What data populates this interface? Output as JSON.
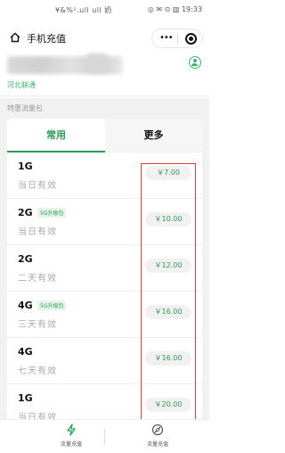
{
  "status_bar": {
    "left": "¥&%¹.ull ull 奶",
    "right": "◎ ✉ ⊙ ▥ 19:33"
  },
  "nav": {
    "title": "手机充值",
    "menu_dots": "•••"
  },
  "phone": {
    "carrier": "河北联通"
  },
  "section": {
    "label": "特惠流量包"
  },
  "tabs": {
    "active": "常用",
    "other": "更多"
  },
  "packages": [
    {
      "data": "1G",
      "badge": "",
      "validity": "当日有效",
      "price": "￥7.00"
    },
    {
      "data": "2G",
      "badge": "5G升级包",
      "validity": "当日有效",
      "price": "￥10.00"
    },
    {
      "data": "2G",
      "badge": "",
      "validity": "二天有效",
      "price": "￥12.00"
    },
    {
      "data": "4G",
      "badge": "5G升级包",
      "validity": "三天有效",
      "price": "￥16.00"
    },
    {
      "data": "4G",
      "badge": "",
      "validity": "七天有效",
      "price": "￥16.00"
    },
    {
      "data": "1G",
      "badge": "",
      "validity": "当日有效",
      "price": "￥20.00"
    }
  ],
  "tabbar": {
    "left_label": "流量充值",
    "right_label": "流量充值"
  },
  "colors": {
    "accent": "#2a9c56",
    "highlight": "#e23b3b"
  }
}
